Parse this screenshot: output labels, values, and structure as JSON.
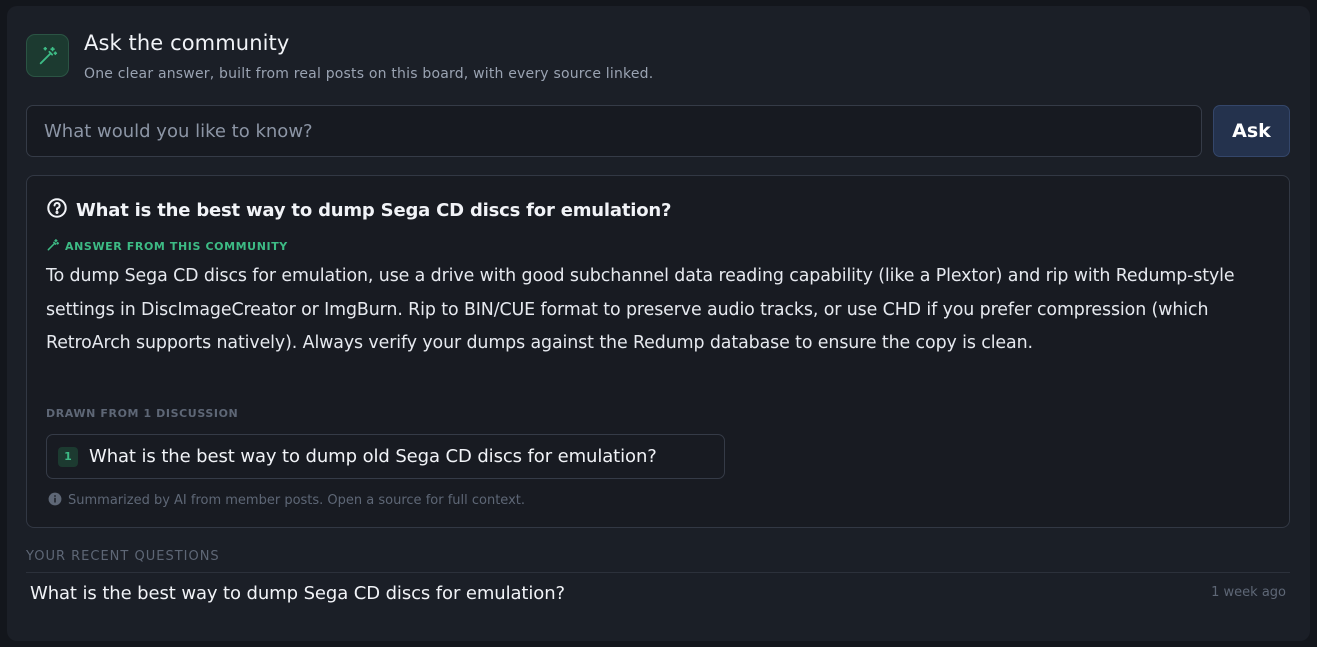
{
  "header": {
    "title": "Ask the community",
    "subtitle": "One clear answer, built from real posts on this board, with every source linked.",
    "icon": "magic-wand-icon"
  },
  "search": {
    "placeholder": "What would you like to know?",
    "value": "",
    "button_label": "Ask"
  },
  "answer": {
    "question": "What is the best way to dump Sega CD discs for emulation?",
    "label": "ANSWER FROM THIS COMMUNITY",
    "body": "To dump Sega CD discs for emulation, use a drive with good subchannel data reading capability (like a Plextor) and rip with Redump-style settings in DiscImageCreator or ImgBurn. Rip to BIN/CUE format to preserve audio tracks, or use CHD if you prefer compression (which RetroArch supports natively). Always verify your dumps against the Redump database to ensure the copy is clean.",
    "sources_label": "DRAWN FROM 1 DISCUSSION",
    "sources": [
      {
        "number": "1",
        "title": "What is the best way to dump old Sega CD discs for emulation?"
      }
    ],
    "disclaimer": "Summarized by AI from member posts. Open a source for full context."
  },
  "recent": {
    "label": "YOUR RECENT QUESTIONS",
    "items": [
      {
        "question": "What is the best way to dump Sega CD discs for emulation?",
        "time": "1 week ago"
      }
    ]
  },
  "colors": {
    "background": "#13161c",
    "panel": "#1b1f27",
    "accent_green": "#3dbb85",
    "ask_button": "#24324d"
  }
}
